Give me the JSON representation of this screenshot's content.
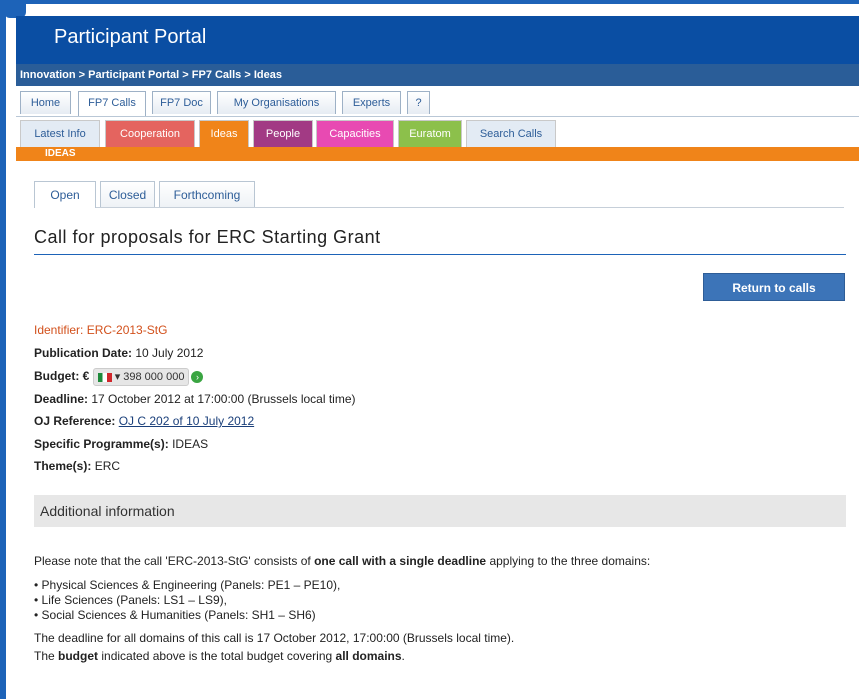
{
  "header": {
    "title": "Participant Portal"
  },
  "breadcrumb": "Innovation > Participant Portal > FP7 Calls > Ideas",
  "main_tabs": [
    {
      "label": "Home"
    },
    {
      "label": "FP7 Calls"
    },
    {
      "label": "FP7 Doc"
    },
    {
      "label": "My Organisations"
    },
    {
      "label": "Experts"
    },
    {
      "label": "?"
    }
  ],
  "programme_tabs": [
    {
      "label": "Latest Info",
      "color": "#e3ebf4",
      "text": "#2d5d98"
    },
    {
      "label": "Cooperation",
      "color": "#e4645f",
      "text": "#ffffff"
    },
    {
      "label": "Ideas",
      "color": "#f08419",
      "text": "#ffffff"
    },
    {
      "label": "People",
      "color": "#a23a84",
      "text": "#ffffff"
    },
    {
      "label": "Capacities",
      "color": "#e84ab2",
      "text": "#ffffff"
    },
    {
      "label": "Euratom",
      "color": "#8cc04b",
      "text": "#ffffff"
    },
    {
      "label": "Search Calls",
      "color": "#e3ebf4",
      "text": "#2d5d98"
    }
  ],
  "section_bar": "IDEAS",
  "sub_tabs": [
    {
      "label": "Open"
    },
    {
      "label": "Closed"
    },
    {
      "label": "Forthcoming"
    }
  ],
  "page_title": "Call for proposals for ERC Starting Grant",
  "return_button": "Return to calls",
  "details": {
    "identifier_label": "Identifier:",
    "identifier_value": "ERC-2013-StG",
    "publication_label": "Publication Date:",
    "publication_value": "10 July 2012",
    "budget_label": "Budget: €",
    "budget_value": "398 000 000",
    "deadline_label": "Deadline:",
    "deadline_value": "17 October 2012 at 17:00:00 (Brussels local time)",
    "oj_label": "OJ Reference:",
    "oj_value": "OJ C 202 of 10 July 2012",
    "programme_label": "Specific Programme(s):",
    "programme_value": "IDEAS",
    "theme_label": "Theme(s):",
    "theme_value": "ERC"
  },
  "additional": {
    "heading": "Additional information",
    "p1_a": "Please note that the call 'ERC-2013-StG' consists of ",
    "p1_b": "one call with a single deadline",
    "p1_c": " applying to the three domains:",
    "bullets": [
      "• Physical Sciences & Engineering (Panels: PE1 – PE10),",
      "• Life Sciences (Panels: LS1 – LS9),",
      "• Social Sciences & Humanities (Panels: SH1 – SH6)"
    ],
    "p2": "The deadline for all domains of this call is 17 October 2012, 17:00:00 (Brussels local time).",
    "p3_a": "The ",
    "p3_b": "budget",
    "p3_c": " indicated above is the total budget covering ",
    "p3_d": "all domains",
    "p3_e": "."
  }
}
